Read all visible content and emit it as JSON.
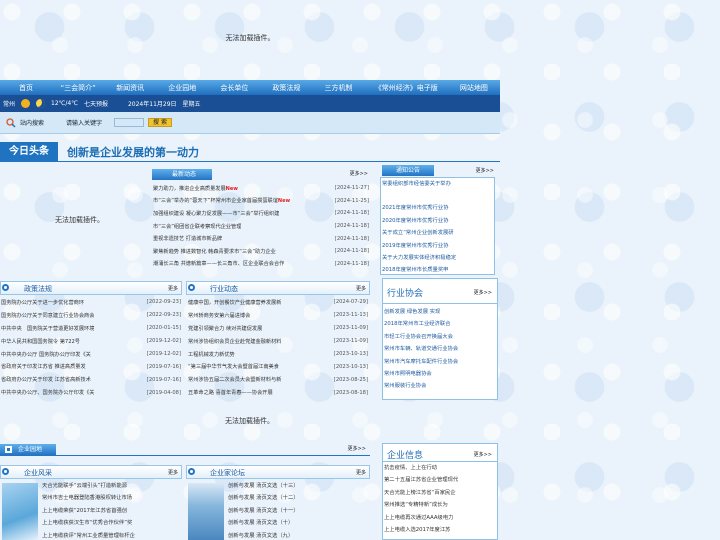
{
  "banner": {
    "message": "无法加载插件。"
  },
  "nav": {
    "items": [
      "首页",
      "“三会简介”",
      "新闻资讯",
      "企业园地",
      "会长单位",
      "政策法规",
      "三方机制",
      "《常州经济》电子版",
      "网站地图"
    ]
  },
  "weather": {
    "city": "常州",
    "temp": "12℃/4℃",
    "forecast": "七天预报",
    "date": "2024年11月29日",
    "weekday": "星期五"
  },
  "search": {
    "label": "站内搜索",
    "placeholder": "请输入关键字",
    "button": "搜 索"
  },
  "headline": {
    "tag": "今日头条",
    "title": "创新是企业发展的第一动力"
  },
  "ad_left": {
    "message": "无法加载插件。"
  },
  "news": {
    "title": "最新动态",
    "more": "更多>>",
    "items": [
      {
        "t": "聚力助力，推进企业高质量发展",
        "d": "[2024-11-27]",
        "new": "New"
      },
      {
        "t": "市“三会”举办的“蓉天下”杯常州市企业家首届掼蛋联谊",
        "d": "[2024-11-25]",
        "new": "New"
      },
      {
        "t": "加强组织建设 凝心聚力促发展——市“三会”举行组织建",
        "d": "[2024-11-18]",
        "new": ""
      },
      {
        "t": "市“三会”组团省企联考察现代企业管理",
        "d": "[2024-11-18]",
        "new": ""
      },
      {
        "t": "重视非遗技艺 打造城市新品牌",
        "d": "[2024-11-18]",
        "new": ""
      },
      {
        "t": "聚焦新趋势 推进数智化 韩森青要求市“三会”助力企业",
        "d": "[2024-11-18]",
        "new": ""
      },
      {
        "t": "潮涌长三角 共谱新篇章——长三角市、区企业联合会合作",
        "d": "[2024-11-18]",
        "new": ""
      }
    ]
  },
  "notices": {
    "title": "通知公告",
    "more": "更多>>",
    "items": [
      "常委组织部市经信委关于举办",
      "2021年度常州市优秀行业协",
      "2020年度常州市优秀行业协",
      "关于成立“常州企业创新发展研",
      "2019年度常州市优秀行业协",
      "关于大力发展实体经济积极稳定",
      "2018年度常州市长质量奖申"
    ]
  },
  "policy": {
    "title": "政策法规",
    "more": "更多",
    "items": [
      {
        "t": "国务院办公厅关于进一步优化营商环",
        "d": "[2022-09-23]"
      },
      {
        "t": "国务院办公厅关于同意建立行业协会商会",
        "d": "[2022-09-23]"
      },
      {
        "t": "中共中央　国务院关于营造更好发展环境",
        "d": "[2020-01-15]"
      },
      {
        "t": "中华人民共和国国务院令 第722号",
        "d": "[2019-12-02]"
      },
      {
        "t": "中共中央办公厅 国务院办公厅印发《关",
        "d": "[2019-12-02]"
      },
      {
        "t": "省政府关于印发江苏省 推进高质量发",
        "d": "[2019-07-16]"
      },
      {
        "t": "省政府办公厅关于印发 江苏省高新技术",
        "d": "[2019-07-16]"
      },
      {
        "t": "中共中央办公厅、国务院办公厅印发《关",
        "d": "[2019-04-08]"
      }
    ]
  },
  "industry": {
    "title": "行业动态",
    "more": "更多",
    "items": [
      {
        "t": "健康中国，开创餐饮产业健康营养发展新",
        "d": "[2024-07-29]"
      },
      {
        "t": "常州轿商务安第六届进博会",
        "d": "[2023-11-13]"
      },
      {
        "t": "党建引领聚合力 续对共建促发展",
        "d": "[2023-11-09]"
      },
      {
        "t": "常州涉协组织会员企业赴党建金融新材料",
        "d": "[2023-11-09]"
      },
      {
        "t": "工程机械发力新优势",
        "d": "[2023-10-13]"
      },
      {
        "t": "“第三届中华节气发大会暨首届江南美食",
        "d": "[2023-10-13]"
      },
      {
        "t": "常州涉协五届二次会员大会暨新材料与新",
        "d": "[2023-08-25]"
      },
      {
        "t": "丑革命之路 喜首年青春——协会开展",
        "d": "[2023-08-18]"
      }
    ]
  },
  "associations": {
    "title": "行业协会",
    "more": "更多>>",
    "items": [
      "创新发展 绿色发展 实现",
      "2018年常州市工业经济联合",
      "市轻工行业协会召开换届大会",
      "常州市车辆、轨道交通行业协会",
      "常州市汽车摩托车配件行业协会",
      "常州市照明电器协会",
      "常州服装行业协会"
    ]
  },
  "ad_mid": {
    "message": "无法加载插件。"
  },
  "garden": {
    "title": "企业园地",
    "more": "更多>>"
  },
  "style": {
    "title": "企业风采",
    "more": "更多",
    "items": [
      "天合光能联手“云端引头”打造新能源",
      "常州市吉士电器登陆香港股权转让市场",
      "上上电缆荣获“2017年江苏省首强创",
      "上上电缆获获汉生市“优秀合作伙伴”奖",
      "上上电缆获评“常州工业质量管理标杆企"
    ]
  },
  "forum": {
    "title": "企业家论坛",
    "more": "更多",
    "items": [
      "创新与发展 汤页文选（十三）",
      "创新与发展 汤页文选（十二）",
      "创新与发展 汤页文选（十一）",
      "创新与发展 汤页文选（十）",
      "创新与发展 汤页文选（九）"
    ]
  },
  "info": {
    "title": "企业信息",
    "more": "更多>>",
    "items": [
      "抗击疫情、上上在行动",
      "第二十五届江苏省企业管理现代",
      "天合光能上榜江苏省“百家民企",
      "常州推选“专精特新”成长为",
      "上上电缆再次通过AAA级电力",
      "上上电缆入选2017年度江苏"
    ]
  }
}
